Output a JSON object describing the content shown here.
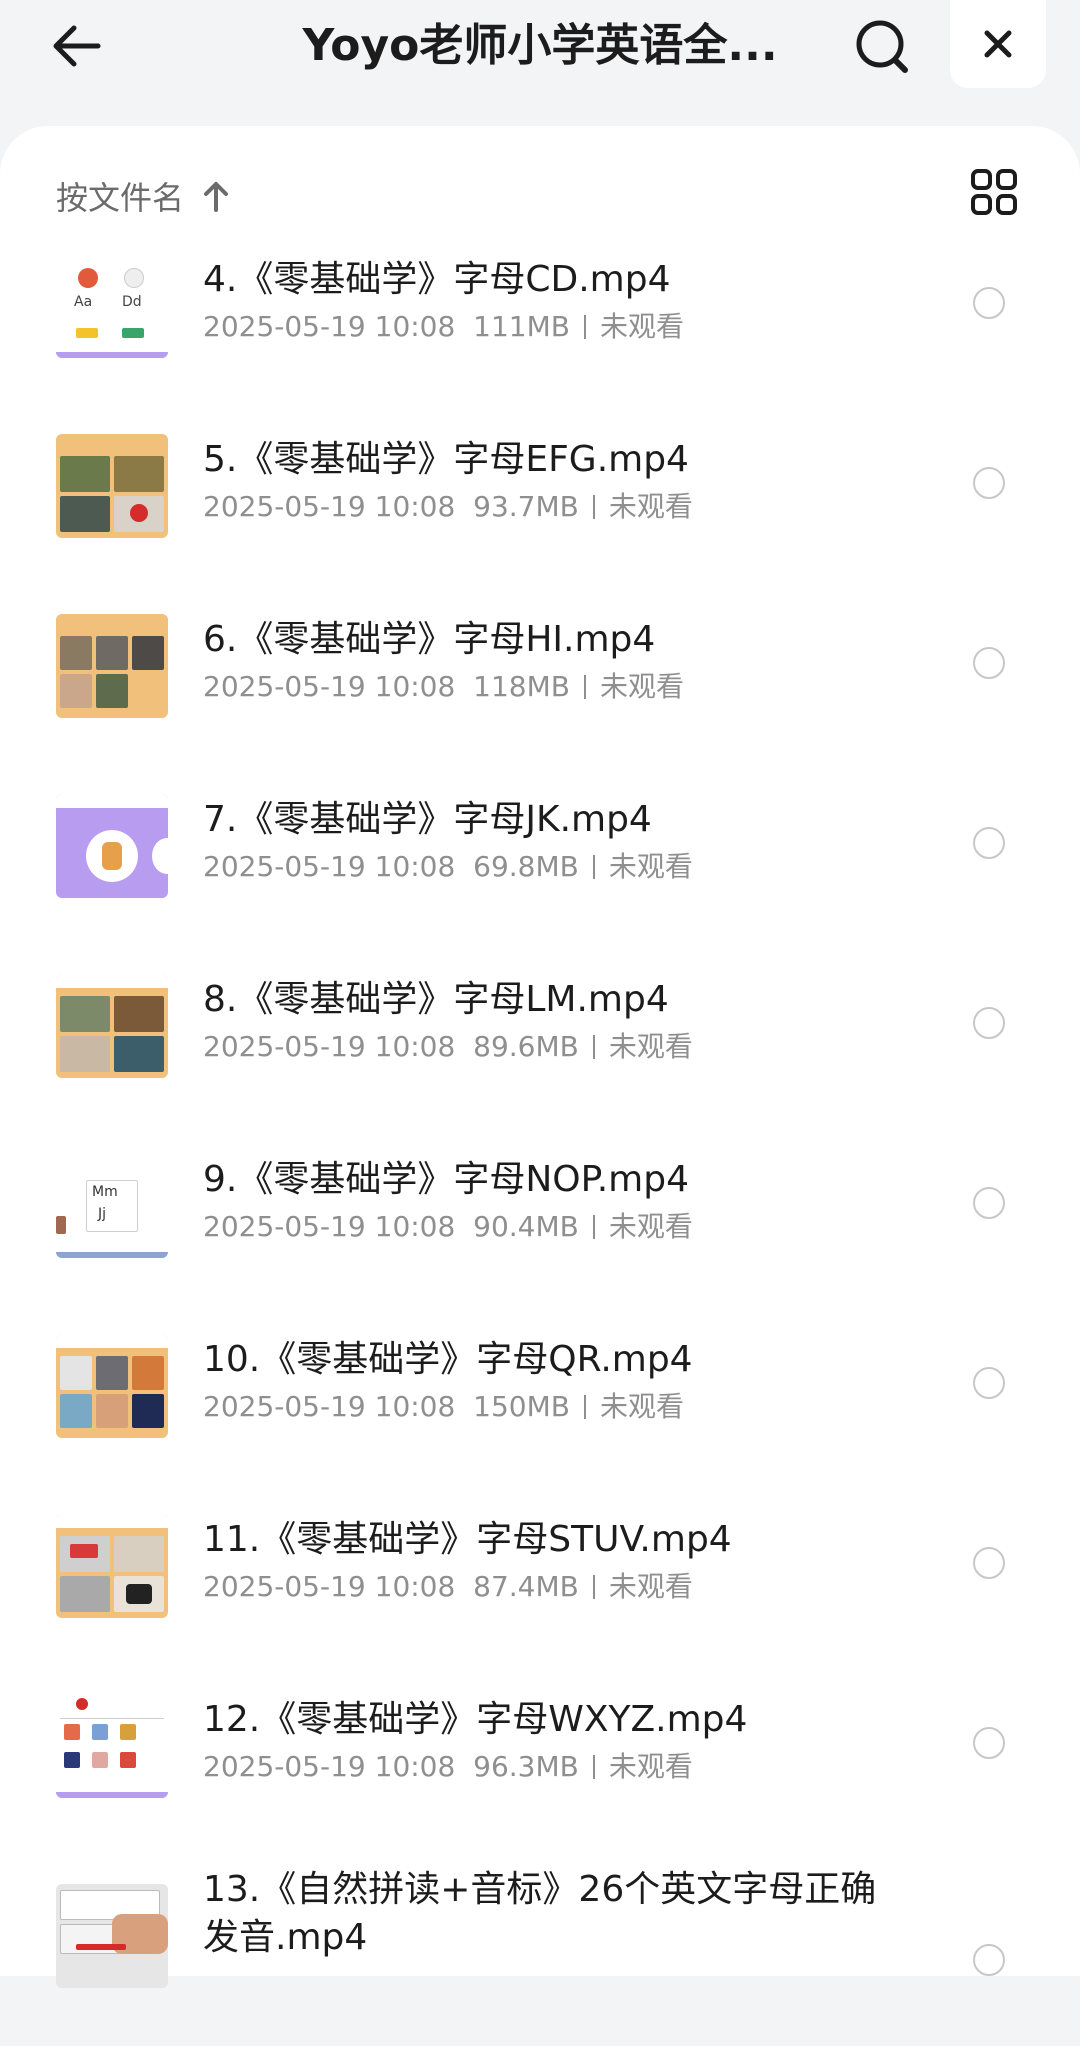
{
  "header": {
    "title": "Yoyo老师小学英语全...",
    "back_icon": "arrow-left-icon",
    "search_icon": "search-icon",
    "close_icon": "close-icon"
  },
  "toolbar": {
    "sort_label": "按文件名",
    "sort_direction_icon": "arrow-up-icon",
    "view_toggle_icon": "grid-view-icon"
  },
  "files": [
    {
      "name": "4.《零基础学》字母CD.mp4",
      "date": "2025-05-19 10:08",
      "size": "111MB",
      "status": "未观看"
    },
    {
      "name": "5.《零基础学》字母EFG.mp4",
      "date": "2025-05-19 10:08",
      "size": "93.7MB",
      "status": "未观看"
    },
    {
      "name": "6.《零基础学》字母HI.mp4",
      "date": "2025-05-19 10:08",
      "size": "118MB",
      "status": "未观看"
    },
    {
      "name": "7.《零基础学》字母JK.mp4",
      "date": "2025-05-19 10:08",
      "size": "69.8MB",
      "status": "未观看"
    },
    {
      "name": "8.《零基础学》字母LM.mp4",
      "date": "2025-05-19 10:08",
      "size": "89.6MB",
      "status": "未观看"
    },
    {
      "name": "9.《零基础学》字母NOP.mp4",
      "date": "2025-05-19 10:08",
      "size": "90.4MB",
      "status": "未观看"
    },
    {
      "name": "10.《零基础学》字母QR.mp4",
      "date": "2025-05-19 10:08",
      "size": "150MB",
      "status": "未观看"
    },
    {
      "name": "11.《零基础学》字母STUV.mp4",
      "date": "2025-05-19 10:08",
      "size": "87.4MB",
      "status": "未观看"
    },
    {
      "name": "12.《零基础学》字母WXYZ.mp4",
      "date": "2025-05-19 10:08",
      "size": "96.3MB",
      "status": "未观看"
    },
    {
      "name": "13.《自然拼读+音标》26个英文字母正确发音.mp4"
    }
  ],
  "colors": {
    "background": "#f3f4f6",
    "sheet": "#ffffff",
    "text": "#1c1c1c",
    "meta_text": "#8f8f8f",
    "thumb_accent": "#f1c07a",
    "thumb_purple": "#b79cf0"
  }
}
